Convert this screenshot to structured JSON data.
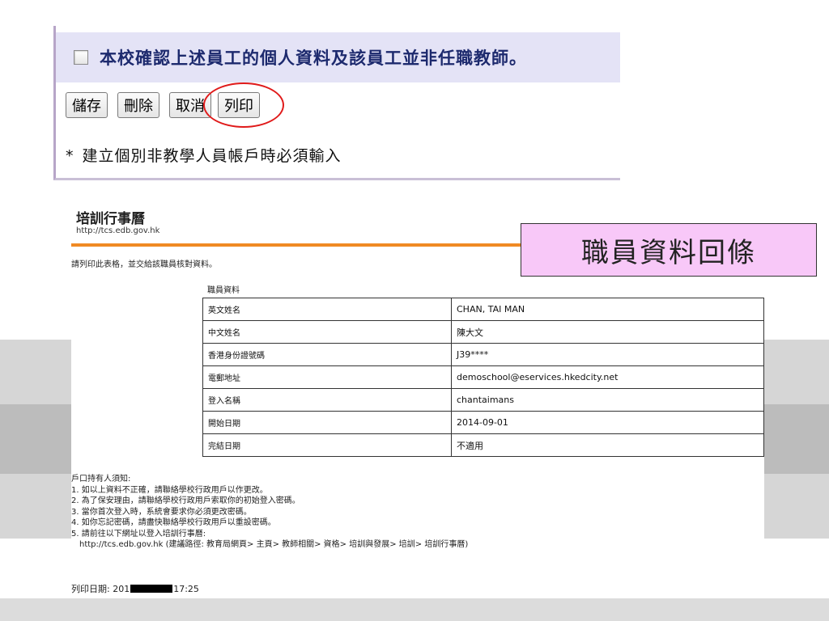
{
  "form": {
    "confirm_text": "本校確認上述員工的個人資料及該員工並非任職教師。",
    "buttons": {
      "save": "儲存",
      "delete": "刪除",
      "cancel": "取消",
      "print": "列印"
    },
    "note_star": "*",
    "note": "建立個別非教學人員帳戶時必須輸入"
  },
  "receipt": {
    "title": "培訓行事曆",
    "url": "http://tcs.edb.gov.hk",
    "instruction": "請列印此表格，並交給該職員核對資料。",
    "section": "職員資料",
    "rows": [
      {
        "label": "英文姓名",
        "value": "CHAN, TAI MAN"
      },
      {
        "label": "中文姓名",
        "value": "陳大文"
      },
      {
        "label": "香港身份證號碼",
        "value": "J39****"
      },
      {
        "label": "電郵地址",
        "value": "demoschool@eservices.hkedcity.net"
      },
      {
        "label": "登入名稱",
        "value": "chantaimans"
      },
      {
        "label": "開始日期",
        "value": "2014-09-01"
      },
      {
        "label": "完結日期",
        "value": "不適用"
      }
    ],
    "notice_title": "戶口持有人須知:",
    "notices": [
      "1. 如以上資料不正確，請聯絡學校行政用戶以作更改。",
      "2. 為了保安理由，請聯絡學校行政用戶索取你的初始登入密碼。",
      "3. 當你首次登入時，系統會要求你必須更改密碼。",
      "4. 如你忘記密碼，請盡快聯絡學校行政用戶以重設密碼。",
      "5. 請前往以下網址以登入培訓行事曆:",
      "http://tcs.edb.gov.hk (建議路徑: 教育局網頁> 主頁> 教師相關> 資格> 培訓與發展> 培訓> 培訓行事曆)"
    ],
    "print_date_label": "列印日期:",
    "print_date_prefix": "201",
    "print_time": "17:25"
  },
  "callout": "職員資料回條"
}
